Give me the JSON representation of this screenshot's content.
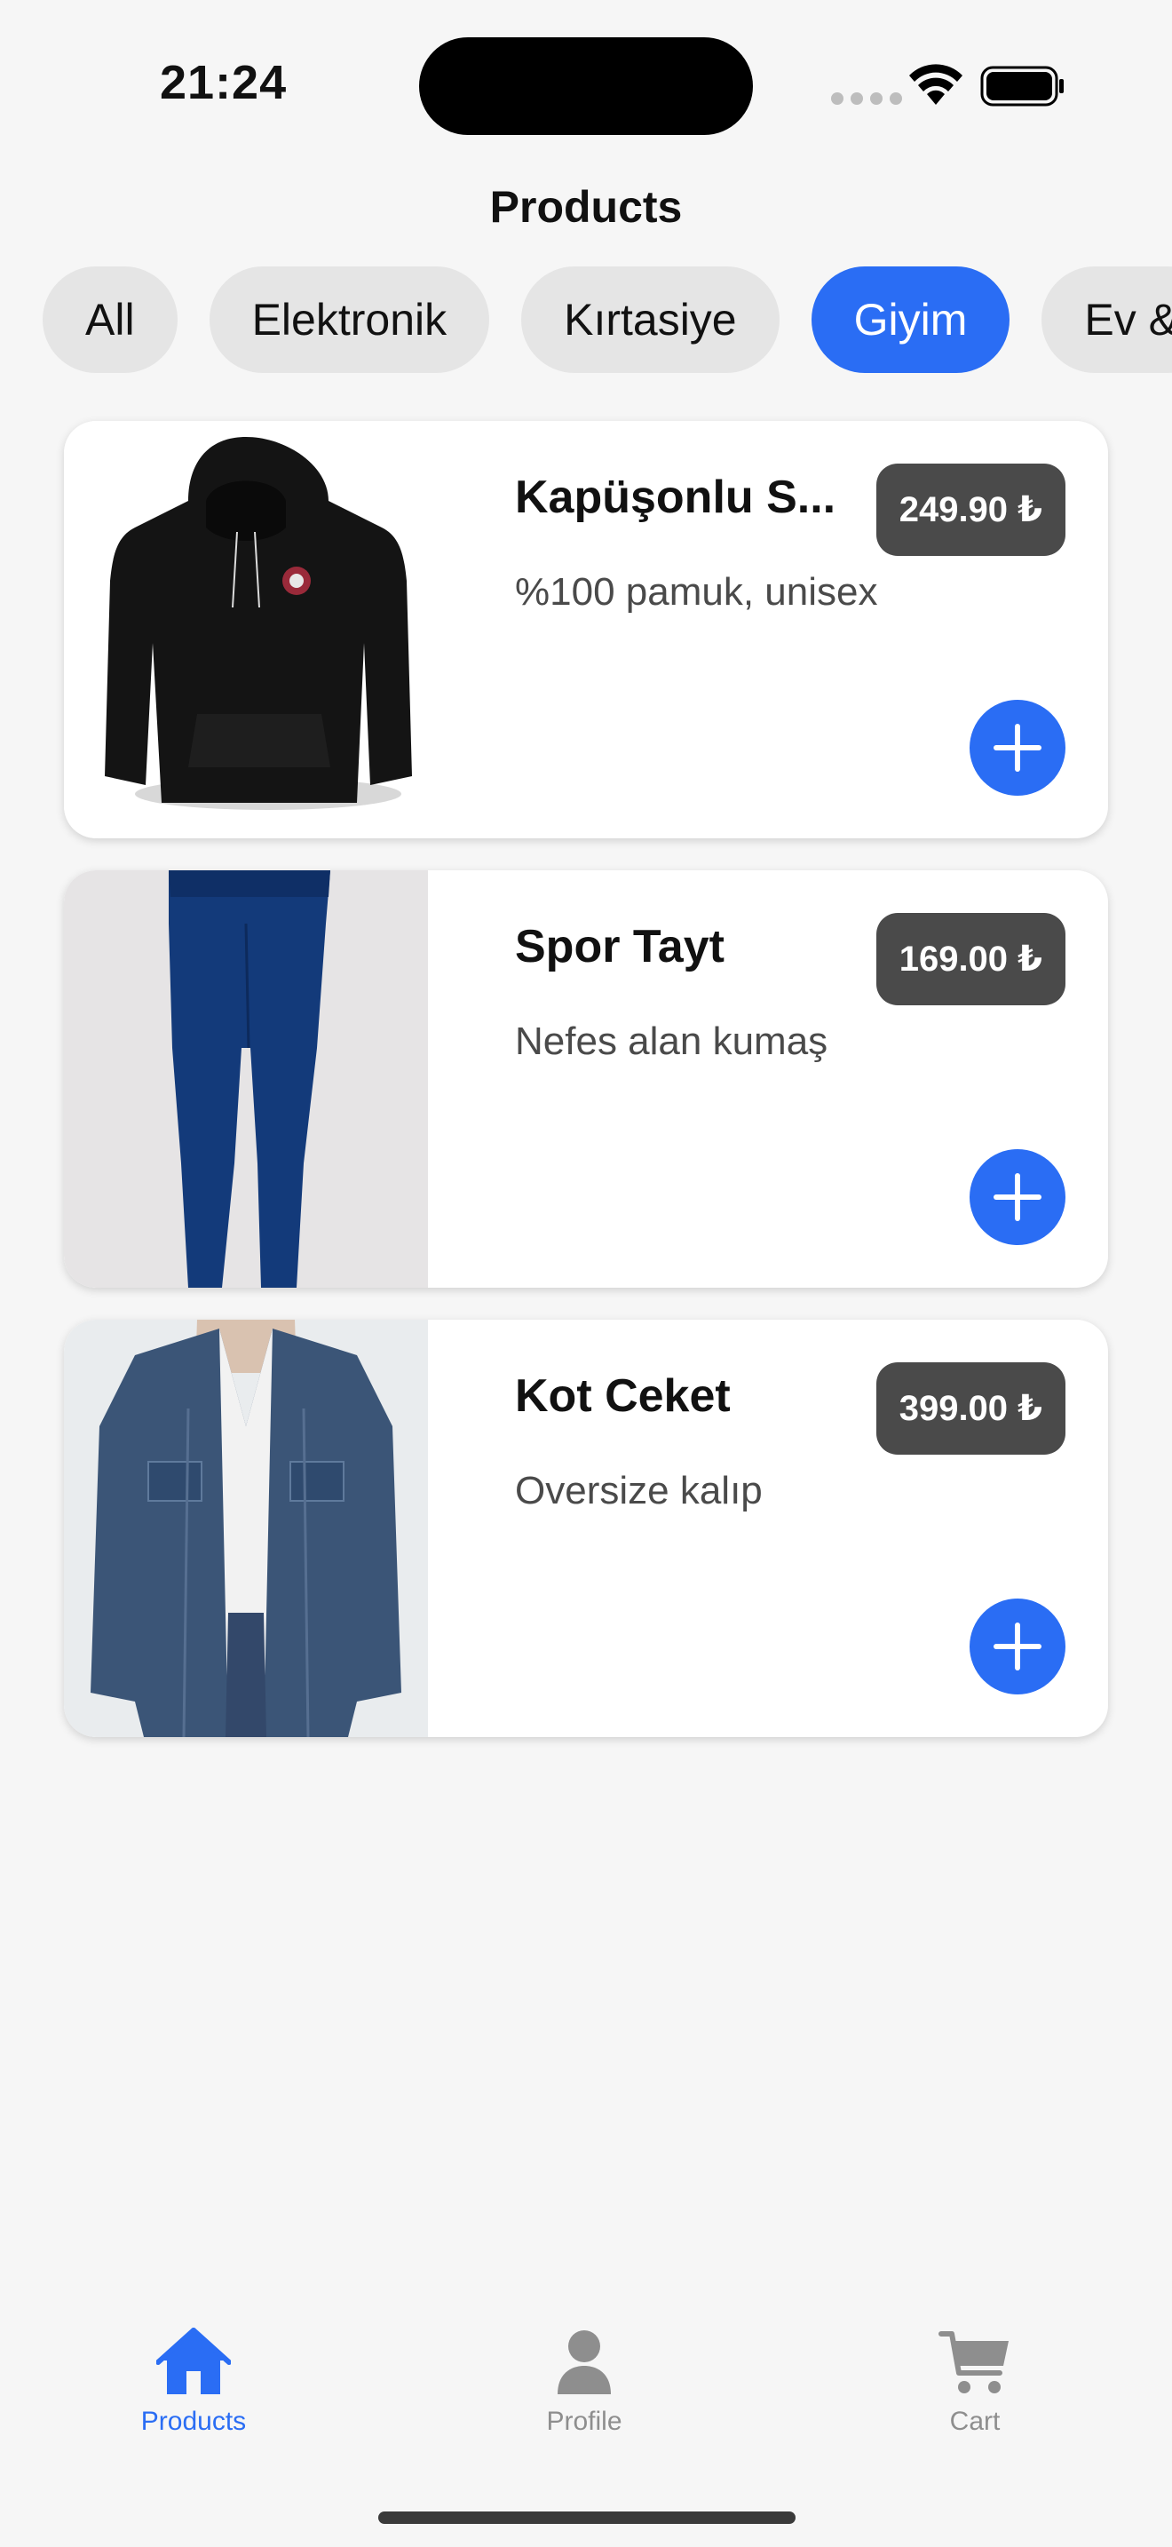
{
  "status_bar": {
    "time": "21:24"
  },
  "header": {
    "title": "Products"
  },
  "categories": [
    {
      "label": "All",
      "selected": false
    },
    {
      "label": "Elektronik",
      "selected": false
    },
    {
      "label": "Kırtasiye",
      "selected": false
    },
    {
      "label": "Giyim",
      "selected": true
    },
    {
      "label": "Ev &",
      "selected": false
    }
  ],
  "products": [
    {
      "name": "Kapüşonlu S...",
      "description": "%100 pamuk, unisex",
      "price": "249.90 ₺",
      "image": "black-hoodie-image"
    },
    {
      "name": "Spor Tayt",
      "description": "Nefes alan kumaş",
      "price": "169.00 ₺",
      "image": "blue-leggings-image"
    },
    {
      "name": "Kot Ceket",
      "description": "Oversize kalıp",
      "price": "399.00 ₺",
      "image": "denim-jacket-image"
    }
  ],
  "tabbar": {
    "items": [
      {
        "label": "Products",
        "icon": "house-icon",
        "active": true
      },
      {
        "label": "Profile",
        "icon": "person-icon",
        "active": false
      },
      {
        "label": "Cart",
        "icon": "cart-icon",
        "active": false
      }
    ]
  },
  "colors": {
    "accent": "#2a6df4",
    "price_badge": "#4a4a4a",
    "background": "#f6f6f6"
  }
}
